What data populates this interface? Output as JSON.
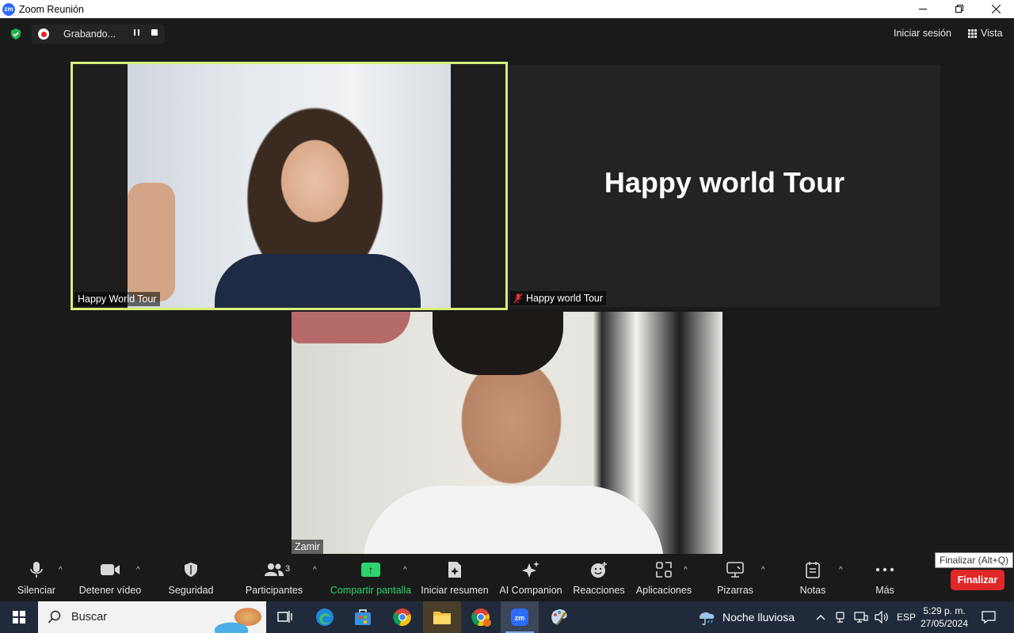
{
  "window": {
    "title": "Zoom Reunión",
    "app_logo": "zm",
    "minimize_icon": "minimize-icon",
    "maximize_icon": "restore-icon",
    "close_icon": "close-icon"
  },
  "meeting_bar": {
    "recording_label": "Grabando...",
    "sign_in": "Iniciar sesión",
    "view": "Vista"
  },
  "tiles": [
    {
      "name": "Happy World Tour",
      "type": "video"
    },
    {
      "name": "Happy world Tour",
      "type": "name-card",
      "display_text": "Happy world Tour",
      "muted": true
    },
    {
      "name": "Zamir",
      "type": "video"
    }
  ],
  "toolbar": {
    "mute": "Silenciar",
    "video": "Detener vídeo",
    "security": "Seguridad",
    "participants": "Participantes",
    "participant_count": "3",
    "share": "Compartir pantalla",
    "summary": "Iniciar resumen",
    "ai": "AI Companion",
    "reactions": "Reacciones",
    "apps": "Aplicaciones",
    "whiteboards": "Pizarras",
    "notes": "Notas",
    "more": "Más",
    "end": "Finalizar",
    "end_tooltip": "Finalizar (Alt+Q)"
  },
  "taskbar": {
    "search_placeholder": "Buscar",
    "weather": "Noche lluviosa",
    "language": "ESP",
    "time": "5:29 p. m.",
    "date": "27/05/2024"
  },
  "colors": {
    "active_speaker_border": "#d6ef7a",
    "share_green": "#2fd36d",
    "end_red": "#e02828",
    "taskbar_bg": "#202a3a"
  }
}
